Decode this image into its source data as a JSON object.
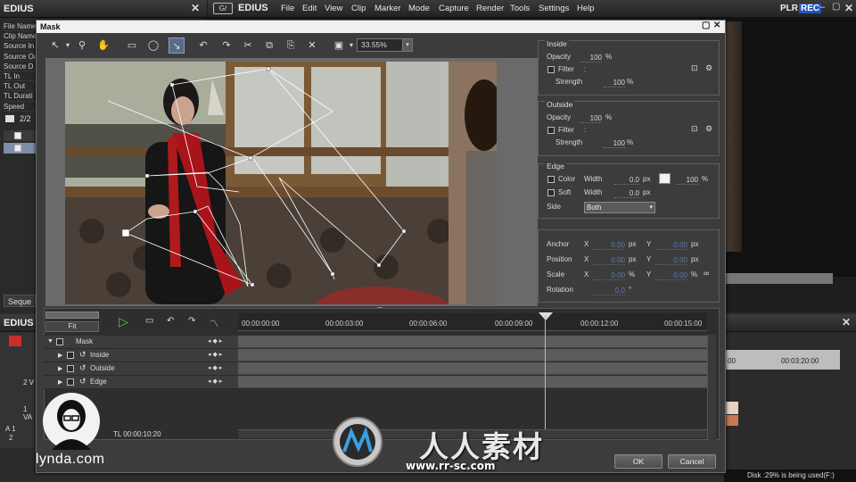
{
  "left_panel": {
    "title": "EDIUS",
    "properties": [
      "File Name",
      "Clip Name",
      "Source In",
      "Source Out",
      "Source D",
      "TL In",
      "TL Out",
      "TL Durati",
      "Speed"
    ],
    "page_count": "2/2",
    "tab_label": "Seque"
  },
  "main_window": {
    "title": "EDIUS",
    "menu": [
      "File",
      "Edit",
      "View",
      "Clip",
      "Marker",
      "Mode",
      "Capture",
      "Render",
      "Tools",
      "Settings",
      "Help"
    ],
    "plr_label": "PLR",
    "rec_label": "REC"
  },
  "timeline_window": {
    "title": "EDIUS",
    "time_label": "00:03:20:00",
    "time_prefix": "00",
    "track_labels": [
      "2 V",
      "1 VA",
      "A 1",
      "2"
    ]
  },
  "mask_dialog": {
    "title": "Mask",
    "zoom": "33.55%",
    "inside": {
      "title": "Inside",
      "opacity_label": "Opacity",
      "opacity_value": "100",
      "opacity_unit": "%",
      "filter_label": "Filter",
      "filter_colon": ":",
      "strength_label": "Strength",
      "strength_value": "100",
      "strength_unit": "%"
    },
    "outside": {
      "title": "Outside",
      "opacity_label": "Opacity",
      "opacity_value": "100",
      "opacity_unit": "%",
      "filter_label": "Filter",
      "filter_colon": ":",
      "strength_label": "Strength",
      "strength_value": "100",
      "strength_unit": "%"
    },
    "edge": {
      "title": "Edge",
      "color_label": "Color",
      "soft_label": "Soft",
      "width_label": "Width",
      "color_width_value": "0.0",
      "soft_width_value": "0.0",
      "px_unit": "px",
      "color_percent": "100",
      "percent_unit": "%",
      "side_label": "Side",
      "side_value": "Both"
    },
    "transform": {
      "anchor_label": "Anchor",
      "position_label": "Position",
      "scale_label": "Scale",
      "rotation_label": "Rotation",
      "x_label": "X",
      "y_label": "Y",
      "anchor_x": "0.00",
      "anchor_y": "0.00",
      "position_x": "0.00",
      "position_y": "0.00",
      "scale_x": "0.00",
      "scale_y": "0.00",
      "rotation": "0.0",
      "px_unit": "px",
      "percent_unit": "%",
      "degree_unit": "°"
    },
    "timeline": {
      "fit_label": "Fit",
      "timecodes": [
        "00:00:00:00",
        "00:00:03:00",
        "00:00:06:00",
        "00:00:09:00",
        "00:00:12:00",
        "00:00:15:00"
      ],
      "tracks": [
        "Mask",
        "Inside",
        "Outside",
        "Edge"
      ],
      "tl_timecode": "TL 00:00:10:20"
    },
    "ok_label": "OK",
    "cancel_label": "Cancel"
  },
  "status": {
    "disk": "Disk :29% is being used(F:)"
  },
  "watermark": {
    "brand": "lynda.com",
    "site_cn": "人人素材",
    "site_url": "www.rr-sc.com"
  }
}
